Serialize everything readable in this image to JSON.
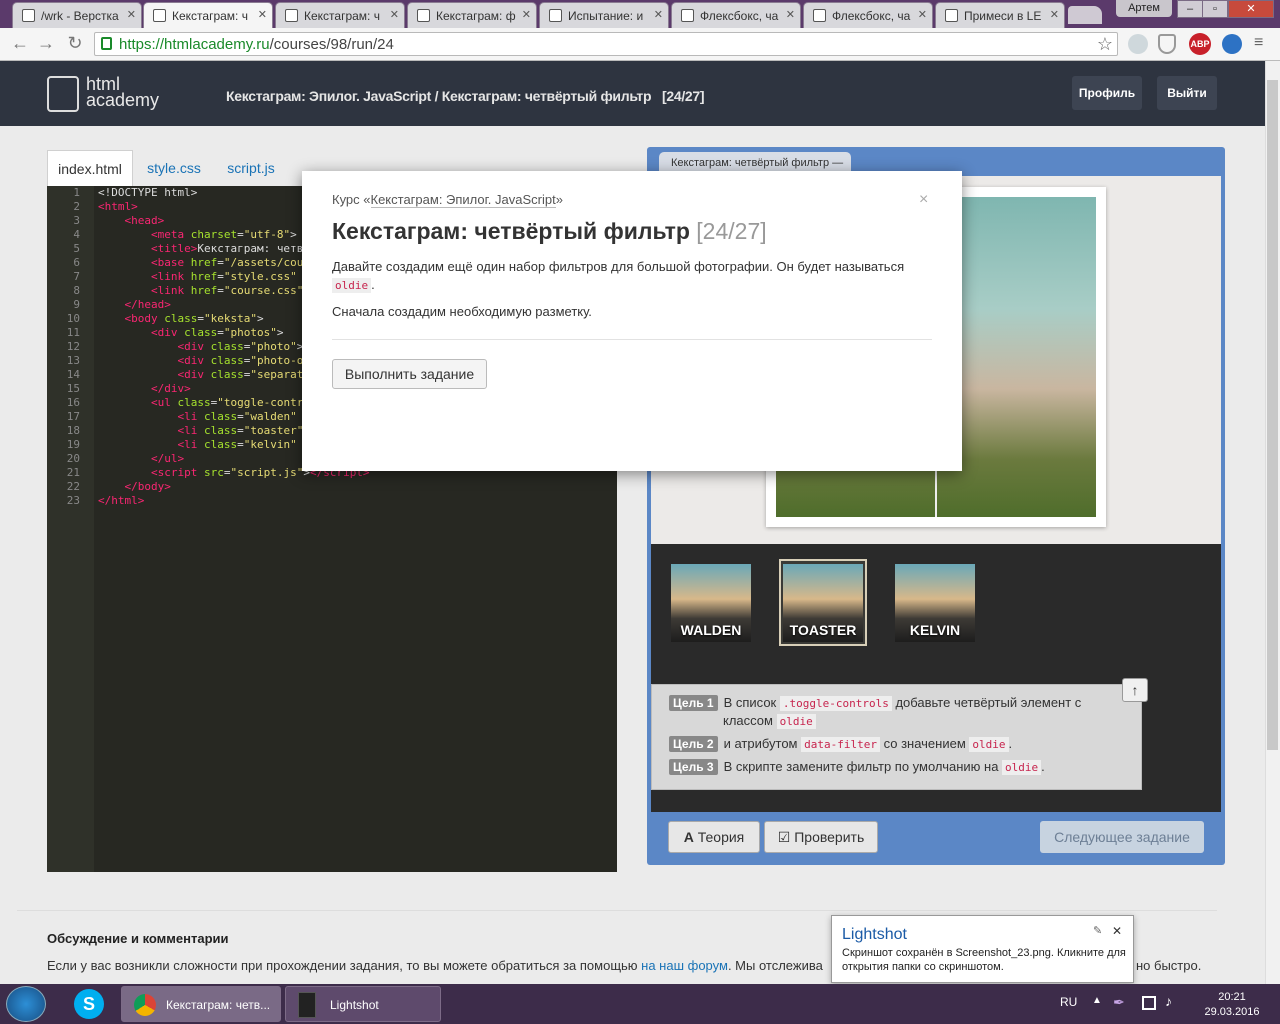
{
  "browser": {
    "tabs": [
      {
        "title": "/wrk - Верстка"
      },
      {
        "title": "Кекстаграм: ч"
      },
      {
        "title": "Кекстаграм: ч"
      },
      {
        "title": "Кекстаграм: ф"
      },
      {
        "title": "Испытание: и"
      },
      {
        "title": "Флексбокс, ча"
      },
      {
        "title": "Флексбокс, ча"
      },
      {
        "title": "Примеси в LE"
      }
    ],
    "user": "Артем",
    "url_host": "https://htmlacademy.ru",
    "url_path": "/courses/98/run/24"
  },
  "header": {
    "logo_line1": "html",
    "logo_line2": "academy",
    "crumb_course": "Кекстаграм: Эпилог. JavaScript",
    "crumb_sep": " / ",
    "crumb_task": "Кекстаграм: четвёртый фильтр",
    "crumb_count": "[24/27]",
    "profile_btn": "Профиль",
    "logout_btn": "Выйти"
  },
  "editor": {
    "tabs": [
      "index.html",
      "style.css",
      "script.js"
    ],
    "line_numbers": [
      "1",
      "2",
      "3",
      "4",
      "5",
      "6",
      "7",
      "8",
      "9",
      "10",
      "11",
      "12",
      "13",
      "14",
      "15",
      "16",
      "17",
      "18",
      "19",
      "20",
      "21",
      "22",
      "23"
    ]
  },
  "preview": {
    "tab_title": "Кекстаграм: четвёртый фильтр —",
    "filters": [
      "WALDEN",
      "TOASTER",
      "KELVIN"
    ],
    "goals": [
      {
        "label": "Цель 1",
        "pre": "В список ",
        "code": ".toggle-controls",
        "post": " добавьте четвёртый элемент с",
        "line2_pre": "классом ",
        "line2_code": "oldie"
      },
      {
        "label": "Цель 2",
        "pre": "и атрибутом ",
        "code": "data-filter",
        "post": " со значением ",
        "code2": "oldie",
        "end": "."
      },
      {
        "label": "Цель 3",
        "pre": "В скрипте замените фильтр по умолчанию на ",
        "code": "oldie",
        "end": "."
      }
    ],
    "theory_btn": "Теория",
    "check_btn": "Проверить",
    "next_btn": "Следующее задание"
  },
  "modal": {
    "course_prefix": "Курс «",
    "course_name": "Кекстаграм: Эпилог. JavaScript",
    "course_suffix": "»",
    "title": "Кекстаграм: четвёртый фильтр",
    "title_num": "[24/27]",
    "text1": "Давайте создадим ещё один набор фильтров для большой фотографии. Он будет называться",
    "text1_code": "oldie",
    "text1_end": ".",
    "text2": "Сначала создадим необходимую разметку.",
    "action_btn": "Выполнить задание",
    "close": "×"
  },
  "discussion": {
    "title": "Обсуждение и комментарии",
    "text_pre": "Если у вас возникли сложности при прохождении задания, то вы можете обратиться за помощью ",
    "link": "на наш форум",
    "text_post": ". Мы отслежива",
    "text_tail": "но быстро."
  },
  "lightshot": {
    "title": "Lightshot",
    "text": "Скриншот сохранён в Screenshot_23.png. Кликните для открытия папки со скриншотом."
  },
  "taskbar": {
    "chrome_item": "Кекстаграм: четв...",
    "lightshot_item": "Lightshot",
    "lang": "RU",
    "time": "20:21",
    "date": "29.03.2016"
  }
}
